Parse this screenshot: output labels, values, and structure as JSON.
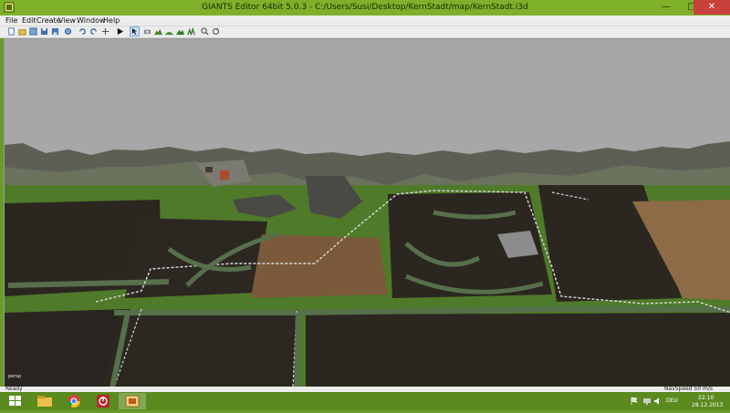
{
  "window": {
    "title": "GIANTS Editor 64bit 5.0.3 - C:/Users/Susi/Desktop/KernStadt/map/KernStadt.i3d",
    "minimize_glyph": "—",
    "maximize_glyph": "□",
    "close_glyph": "✕"
  },
  "menu": [
    "File",
    "Edit",
    "Create",
    "View",
    "Window",
    "Help"
  ],
  "toolbar": {
    "icons": [
      "new-icon",
      "open-icon",
      "import-icon",
      "save-icon",
      "save-as-icon",
      "settings-icon",
      "undo-icon",
      "redo-icon",
      "move-icon",
      "play-icon",
      "select-icon",
      "camera-icon",
      "terrain-sculpt-icon",
      "terrain-smooth-icon",
      "terrain-paint-icon",
      "foliage-paint-icon",
      "zoom-icon",
      "refresh-icon"
    ]
  },
  "viewport": {
    "camera_label": "persp"
  },
  "status": {
    "left": "Ready",
    "right": "NavSpeed 50 m/s"
  },
  "taskbar": {
    "apps": [
      "start-icon",
      "file-explorer-icon",
      "chrome-icon",
      "power-app-icon",
      "giants-editor-icon"
    ],
    "language": "DEU",
    "time": "22:10",
    "date": "28.12.2013"
  },
  "colors": {
    "title_bar": "#7eb02a",
    "taskbar": "#5b8a1e",
    "sky": "#a7a7a7",
    "grass": "#4f7a2a",
    "soil_dark": "#2b2620",
    "soil_plowed": "#7a5a3a",
    "road": "#8a8a8a"
  }
}
